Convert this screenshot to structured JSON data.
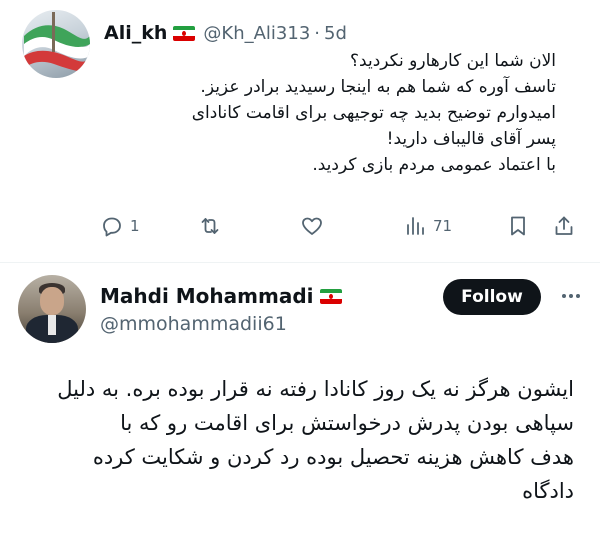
{
  "reply": {
    "author_name": "Ali_kh",
    "author_flag": "iran-flag-icon",
    "handle": "@Kh_Ali313",
    "separator": "·",
    "time": "5d",
    "text_lines": [
      "الان شما این کارهارو نکردید؟",
      "تاسف آوره که شما هم به اینجا رسیدید برادر عزیز.",
      "امیدوارم توضیح بدید چه توجیهی برای اقامت کانادای",
      "پسر آقای قالیباف دارید!",
      "با اعتماد عمومی مردم بازی کردید."
    ],
    "actions": {
      "reply_count": "1",
      "repost_count": "",
      "like_count": "",
      "views_count": "71"
    }
  },
  "main": {
    "author_name": "Mahdi Mohammadi",
    "author_flag": "iran-flag-icon",
    "handle": "@mmohammadii61",
    "follow_label": "Follow",
    "text_lines": [
      "ایشون هرگز نه یک روز کانادا رفته نه قرار بوده بره. به دلیل",
      "سپاهی بودن پدرش درخواستش برای اقامت رو که با",
      "هدف کاهش هزینه تحصیل بوده رد کردن و شکایت کرده",
      "دادگاه"
    ]
  },
  "colors": {
    "text_primary": "#0f1419",
    "text_secondary": "#536471",
    "follow_bg": "#0f1419",
    "follow_text": "#ffffff",
    "divider": "#eff3f4"
  }
}
